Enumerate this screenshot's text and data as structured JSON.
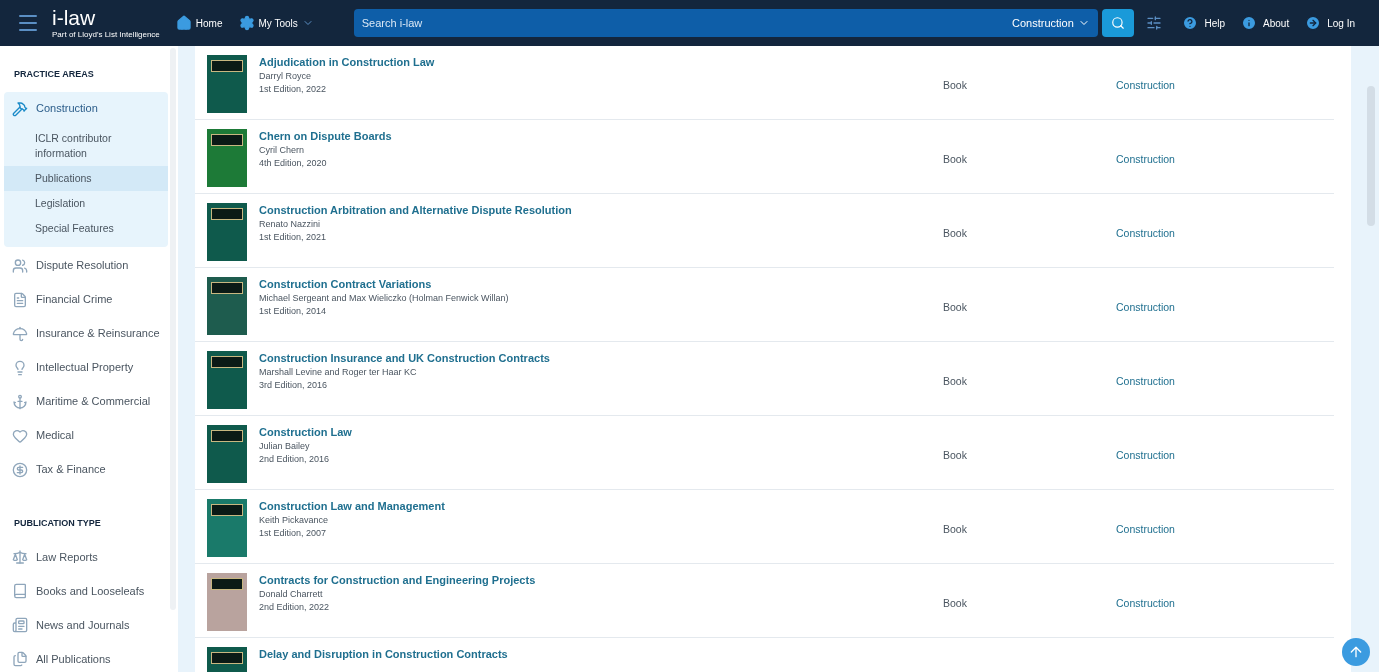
{
  "header": {
    "logo": "i-law",
    "logo_tagline": "Part of Lloyd's List Intelligence",
    "nav": [
      {
        "label": "Home"
      },
      {
        "label": "My Tools"
      }
    ],
    "search": {
      "placeholder": "Search i-law",
      "scope": "Construction"
    },
    "links": [
      {
        "label": "Help"
      },
      {
        "label": "About"
      },
      {
        "label": "Log In"
      }
    ]
  },
  "sidebar": {
    "sections": [
      {
        "heading": "PRACTICE AREAS",
        "items": [
          {
            "label": "Construction",
            "expanded": true,
            "children": [
              {
                "label": "ICLR contributor information",
                "selected": false
              },
              {
                "label": "Publications",
                "selected": true
              },
              {
                "label": "Legislation",
                "selected": false
              },
              {
                "label": "Special Features",
                "selected": false
              }
            ]
          },
          {
            "label": "Dispute Resolution",
            "expanded": false
          },
          {
            "label": "Financial Crime",
            "expanded": false
          },
          {
            "label": "Insurance & Reinsurance",
            "expanded": false
          },
          {
            "label": "Intellectual Property",
            "expanded": false
          },
          {
            "label": "Maritime & Commercial",
            "expanded": false
          },
          {
            "label": "Medical",
            "expanded": false
          },
          {
            "label": "Tax & Finance",
            "expanded": false
          }
        ]
      },
      {
        "heading": "PUBLICATION TYPE",
        "items": [
          {
            "label": "Law Reports",
            "expanded": false
          },
          {
            "label": "Books and Looseleafs",
            "expanded": false
          },
          {
            "label": "News and Journals",
            "expanded": false
          },
          {
            "label": "All Publications",
            "expanded": false
          }
        ]
      }
    ]
  },
  "publications": [
    {
      "title": "Adjudication in Construction Law",
      "author": "Darryl Royce",
      "edition": "1st Edition, 2022",
      "type": "Book",
      "area": "Construction",
      "color": "#0f5a4c"
    },
    {
      "title": "Chern on Dispute Boards",
      "author": "Cyril Chern",
      "edition": "4th Edition, 2020",
      "type": "Book",
      "area": "Construction",
      "color": "#1d7a37"
    },
    {
      "title": "Construction Arbitration and Alternative Dispute Resolution",
      "author": "Renato Nazzini",
      "edition": "1st Edition, 2021",
      "type": "Book",
      "area": "Construction",
      "color": "#0f5a4c"
    },
    {
      "title": "Construction Contract Variations",
      "author": "Michael Sergeant and Max Wieliczko (Holman Fenwick Willan)",
      "edition": "1st Edition, 2014",
      "type": "Book",
      "area": "Construction",
      "color": "#1e5c4e"
    },
    {
      "title": "Construction Insurance and UK Construction Contracts",
      "author": "Marshall Levine and Roger ter Haar KC",
      "edition": "3rd Edition, 2016",
      "type": "Book",
      "area": "Construction",
      "color": "#0f5a4c"
    },
    {
      "title": "Construction Law",
      "author": "Julian Bailey",
      "edition": "2nd Edition, 2016",
      "type": "Book",
      "area": "Construction",
      "color": "#0f5a4c"
    },
    {
      "title": "Construction Law and Management",
      "author": "Keith Pickavance",
      "edition": "1st Edition, 2007",
      "type": "Book",
      "area": "Construction",
      "color": "#1a7a6a"
    },
    {
      "title": "Contracts for Construction and Engineering Projects",
      "author": "Donald Charrett",
      "edition": "2nd Edition, 2022",
      "type": "Book",
      "area": "Construction",
      "color": "#b9a39e"
    },
    {
      "title": "Delay and Disruption in Construction Contracts",
      "color": "#0f5a4c"
    }
  ]
}
